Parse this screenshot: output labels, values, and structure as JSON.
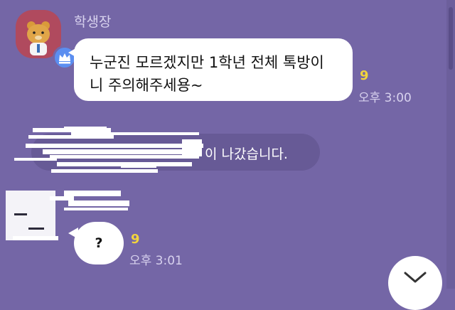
{
  "chat": {
    "sender_name": "학생장",
    "message_1": {
      "line_1": "누군진 모르겠지만 1학년 전체 톡방이",
      "line_2": "니 주의해주세용~",
      "unread_count": "9",
      "time": "오후 3:00"
    },
    "system_message": {
      "text": "이 나갔습니다."
    },
    "message_2": {
      "text": "?",
      "unread_count": "9",
      "time": "오후 3:01"
    }
  },
  "colors": {
    "background": "#7466a6",
    "bubble": "#ffffff",
    "unread": "#f2d43c",
    "time_text": "#d8d2ee",
    "badge": "#5b8ef0"
  },
  "icons": {
    "avatar": "ryan-character-icon",
    "badge": "crown-icon",
    "scroll": "chevron-down-icon"
  }
}
